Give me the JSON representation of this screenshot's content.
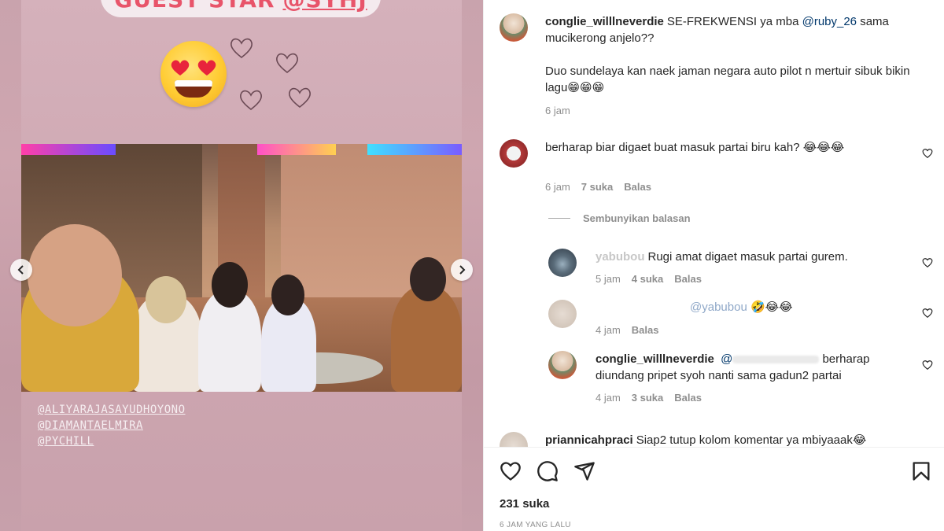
{
  "story": {
    "guest_star_label": "GUEST STAR",
    "guest_star_handle": "@SYHJ",
    "tags": [
      "@ALIYARAJASAYUDHOYONO",
      "@DIAMANTAELMIRA",
      "@PYCHILL"
    ],
    "accent_color": "#e8546a"
  },
  "comments": [
    {
      "username": "conglie_willlneverdie",
      "text_part1": "SE-FREKWENSI ya mba ",
      "mention": "@ruby_26",
      "text_part2": " sama mucikerong anjelo??",
      "text_line2": "Duo sundelaya kan naek jaman negara auto pilot n mertuir sibuk bikin lagu😁😁😁",
      "time": "6 jam"
    },
    {
      "text": "berharap biar digaet buat masuk partai biru kah? 😂😂😂",
      "time": "6 jam",
      "likes": "7 suka",
      "reply": "Balas"
    }
  ],
  "hide_replies_label": "Sembunyikan balasan",
  "replies": [
    {
      "username_partial": "yabubou",
      "text": "Rugi amat digaet masuk partai gurem.",
      "time": "5 jam",
      "likes": "4 suka",
      "reply": "Balas"
    },
    {
      "mention": "@yabubou",
      "text": "🤣😂😂",
      "time": "4 jam",
      "reply": "Balas"
    },
    {
      "username": "conglie_willlneverdie",
      "mention": "@",
      "text": "berharap diundang pripet syoh nanti sama gadun2 partai",
      "time": "4 jam",
      "likes": "3 suka",
      "reply": "Balas"
    }
  ],
  "last_comment": {
    "username": "priannicahpraci",
    "text": "Siap2 tutup kolom komentar ya mbiyaaak😂"
  },
  "post": {
    "likes": "231 suka",
    "time_ago": "6 JAM YANG LALU"
  }
}
